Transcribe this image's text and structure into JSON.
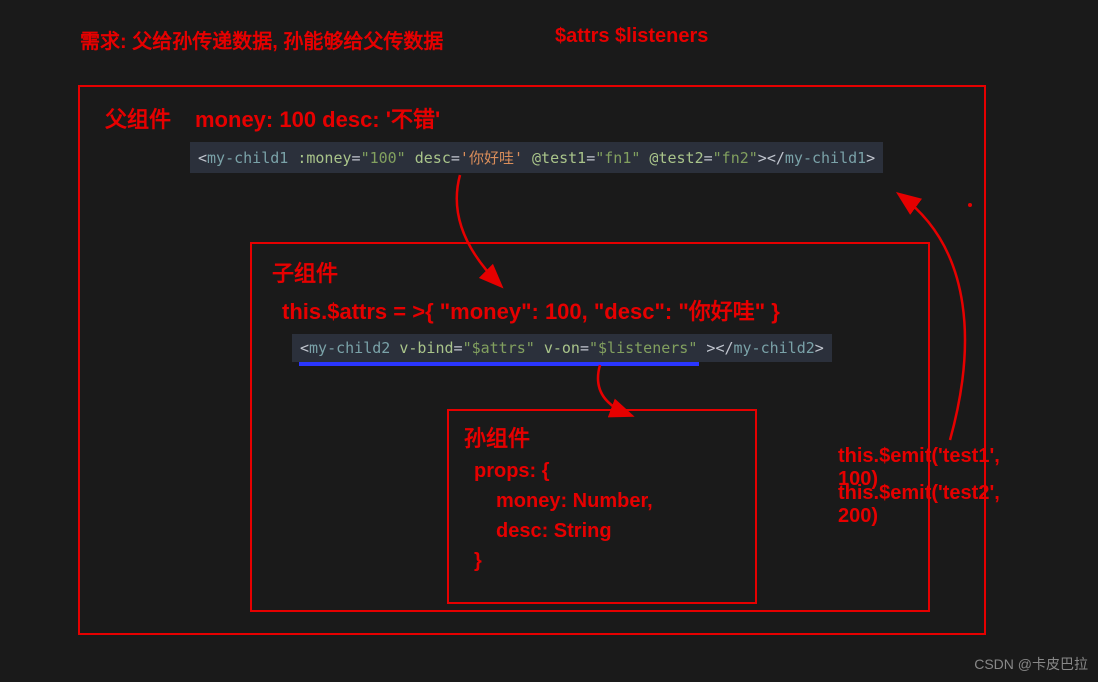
{
  "header": {
    "left": "需求: 父给孙传递数据, 孙能够给父传数据",
    "right": "$attrs  $listeners"
  },
  "parent": {
    "label": "父组件",
    "state": "money: 100    desc: '不错'",
    "code_prefix": "<",
    "code_tag_open": "my-child1",
    "code_attr1": " :money",
    "code_eq": "=",
    "code_val1": "\"100\"",
    "code_attr2": " desc",
    "code_val2a": "'",
    "code_val2b": "你好哇",
    "code_val2c": "'",
    "code_attr3": " @test1",
    "code_val3": "\"fn1\"",
    "code_attr4": " @test2",
    "code_val4": "\"fn2\"",
    "code_close1": ">",
    "code_close2": "</",
    "code_tag_close": "my-child1",
    "code_close3": ">"
  },
  "child": {
    "label": "子组件",
    "attrs_line": "this.$attrs = >{ \"money\": 100, \"desc\": \"你好哇\" }",
    "code_tag": "my-child2",
    "code_attr1": " v-bind",
    "code_val1": "\"$attrs\"",
    "code_attr2": " v-on",
    "code_val2": "\"$listeners\"",
    "code_space": " "
  },
  "grandchild": {
    "label": "孙组件",
    "props_open": "props: {",
    "props_money": "money: Number,",
    "props_desc": "desc: String",
    "props_close": "}"
  },
  "emit": {
    "line1": "this.$emit('test1', 100)",
    "line2": "this.$emit('test2', 200)"
  },
  "watermark": "CSDN @卡皮巴拉"
}
